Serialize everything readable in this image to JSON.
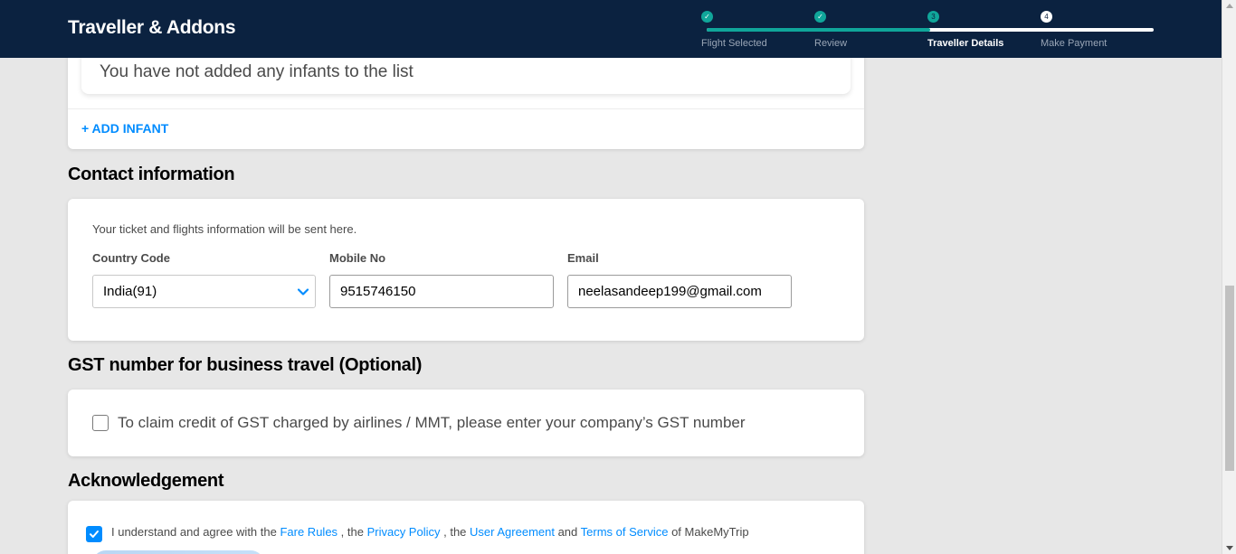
{
  "header": {
    "title": "Traveller & Addons",
    "steps": [
      {
        "label": "Flight Selected",
        "marker": "✓",
        "state": "done"
      },
      {
        "label": "Review",
        "marker": "✓",
        "state": "done"
      },
      {
        "label": "Traveller Details",
        "marker": "3",
        "state": "active"
      },
      {
        "label": "Make Payment",
        "marker": "4",
        "state": "todo"
      }
    ],
    "progress_fraction": 0.5
  },
  "infants": {
    "empty_message": "You have not added any infants to the list",
    "add_label": "+ ADD INFANT"
  },
  "contact": {
    "section_title": "Contact information",
    "hint": "Your ticket and flights information will be sent here.",
    "country_code_label": "Country Code",
    "country_code_value": "India(91)",
    "mobile_label": "Mobile No",
    "mobile_value": "9515746150",
    "email_label": "Email",
    "email_value": "neelasandeep199@gmail.com"
  },
  "gst": {
    "section_title": "GST number for business travel (Optional)",
    "checkbox_label": "To claim credit of GST charged by airlines / MMT, please enter your company’s GST number",
    "checked": false
  },
  "acknowledgement": {
    "section_title": "Acknowledgement",
    "checked": true,
    "text_1": "I understand and agree with the ",
    "fare_rules": "Fare Rules",
    "text_2": " , the ",
    "privacy_policy": "Privacy Policy",
    "text_3": " , the ",
    "user_agreement": "User Agreement",
    "text_4": " and ",
    "terms_of_service": "Terms of Service",
    "text_5": " of MakeMyTrip"
  },
  "colors": {
    "header_bg": "#0b2240",
    "accent_teal": "#10a69a",
    "link_blue": "#008cff"
  }
}
